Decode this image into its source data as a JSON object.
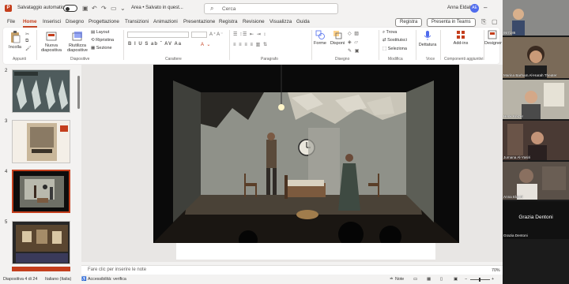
{
  "titlebar": {
    "autosave_label": "Salvataggio automatico",
    "filename": "Area • Salvato in quest...",
    "search_placeholder": "Cerca",
    "user_name": "Anna Eldahl",
    "user_initials": "AE"
  },
  "tabs": [
    "File",
    "Home",
    "Inserisci",
    "Disegno",
    "Progettazione",
    "Transizioni",
    "Animazioni",
    "Presentazione",
    "Registra",
    "Revisione",
    "Visualizza",
    "Guida"
  ],
  "active_tab": "Home",
  "tab_actions": {
    "record": "Registra",
    "present_teams": "Presenta in Teams"
  },
  "ribbon": {
    "paste": "Incolla",
    "new_slide": "Nuova diapositiva",
    "reuse_slides": "Riutilizza diapositive",
    "layout": "Layout",
    "reset": "Ripristina",
    "section": "Sezione",
    "shapes": "Forme",
    "arrange": "Disponi",
    "find": "Trova",
    "replace": "Sostituisci",
    "select": "Seleziona",
    "dictate": "Dettatura",
    "addins": "Add-ins",
    "designer": "Designer",
    "groups": {
      "clipboard": "Appunti",
      "slides": "Diapositive",
      "font": "Carattere",
      "paragraph": "Paragrafo",
      "drawing": "Disegno",
      "editing": "Modifica",
      "voice": "Voce",
      "addins": "Componenti aggiuntivi"
    }
  },
  "slides": [
    {
      "number": "2"
    },
    {
      "number": "3"
    },
    {
      "number": "4"
    },
    {
      "number": "5"
    }
  ],
  "selected_slide": "4",
  "notes_placeholder": "Fare clic per inserire le note",
  "status": {
    "slide_of": "Diapositiva 4 di 24",
    "language": "Italiano (Italia)",
    "accessibility": "Accessibilità: verifica",
    "notes": "Note",
    "zoom": "70%"
  },
  "participants": [
    {
      "name": "Marina Barham Al-Harah Theater"
    },
    {
      "name": "Henk Keizer"
    },
    {
      "name": "Jumana Al-Yasiri"
    },
    {
      "name": "Anna Eldahl"
    },
    {
      "name": "Grazia Dentoni"
    }
  ],
  "participants_top_label": "957186",
  "speaker_name": "Grazia Dentoni",
  "colors": {
    "accent": "#c43e1c",
    "ribbon_bg": "#ffffff",
    "app_bg": "#f3f2f1",
    "panel_bg": "#1b1b1b"
  }
}
